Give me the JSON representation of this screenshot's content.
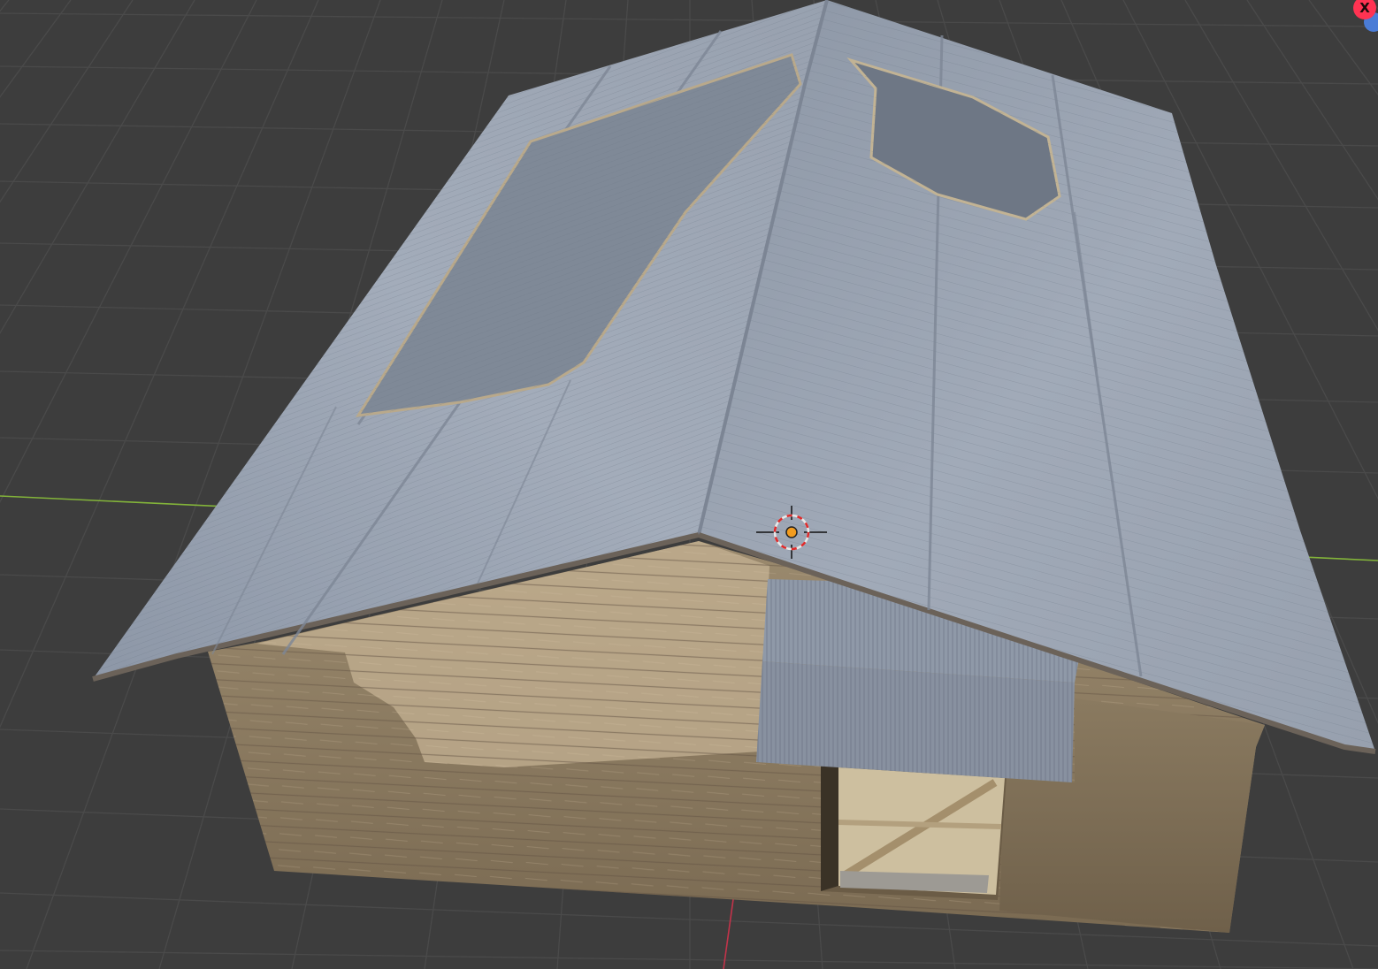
{
  "viewport": {
    "background": "#3d3d3d",
    "grid_color": "#4a4a4a",
    "x_axis_color": "#83b43a",
    "y_axis_color": "#c2334a"
  },
  "cursor": {
    "icon": "3d-cursor-icon",
    "ring_colors": [
      "#e8e8e8",
      "#e02a2a"
    ],
    "center_color": "#f29c1f"
  },
  "navigation_gizmo": {
    "x_label": "X",
    "x_color": "#ff3352",
    "z_color": "#4a7cd6"
  },
  "model": {
    "object": "house",
    "roof_color": "#9aa3b1",
    "wall_color": "#8c7a60"
  }
}
